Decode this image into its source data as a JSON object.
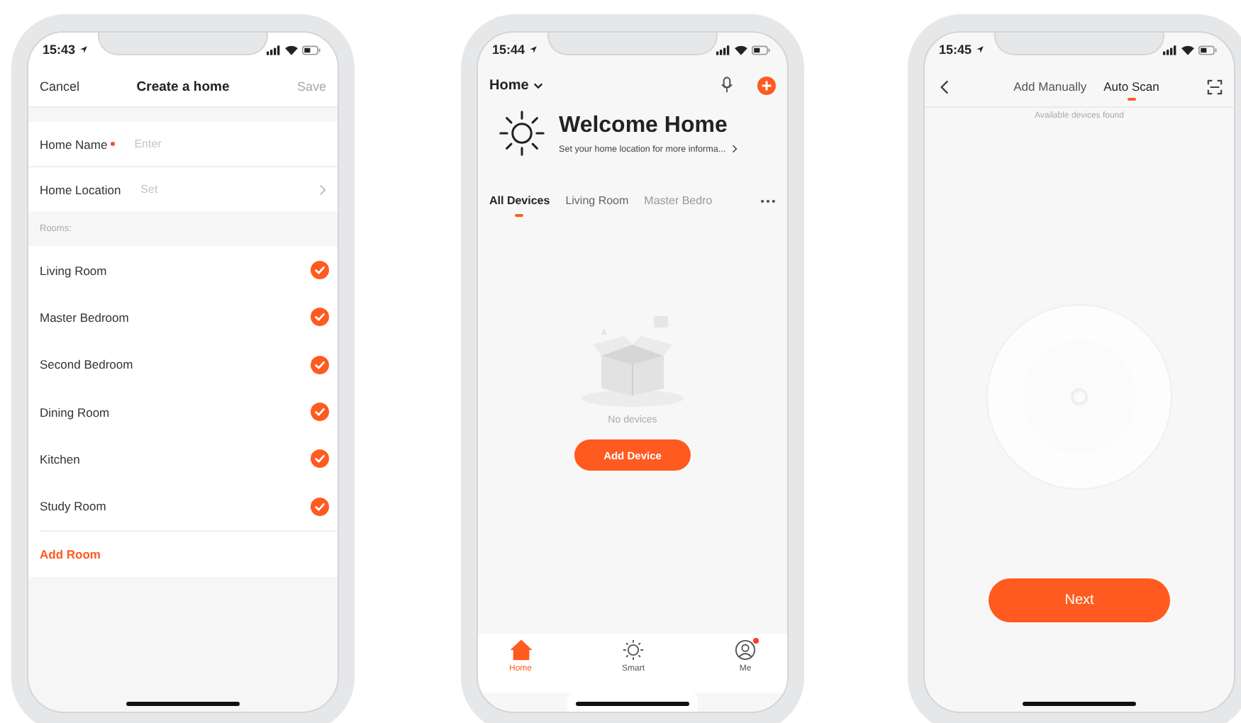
{
  "create_home_screen": {
    "status_bar": {
      "time": "15:43"
    },
    "nav": {
      "cancel": "Cancel",
      "title": "Create a home",
      "save": {
        "label": "Save",
        "disabled": true
      }
    },
    "home_name": {
      "label": "Home Name",
      "required": true,
      "placeholder": "Enter"
    },
    "home_location": {
      "label": "Home Location",
      "placeholder": "Set"
    },
    "rooms_label": "Rooms:",
    "rooms": [
      {
        "name": "Living Room",
        "checked": true
      },
      {
        "name": "Master Bedroom",
        "checked": true
      },
      {
        "name": "Second Bedroom",
        "checked": true
      },
      {
        "name": "Dining Room",
        "checked": true
      },
      {
        "name": "Kitchen",
        "checked": true
      },
      {
        "name": "Study Room",
        "checked": true
      }
    ],
    "add_room": "Add Room"
  },
  "home_screen": {
    "status_bar": {
      "time": "15:44"
    },
    "home_menu": "Home",
    "welcome": {
      "title": "Welcome Home",
      "subtitle": "Set your home location for more informa..."
    },
    "tabs": [
      {
        "label": "All Devices",
        "selected": true
      },
      {
        "label": "Living Room",
        "selected": false
      },
      {
        "label": "Master Bedro",
        "selected": false
      }
    ],
    "empty_message": "No devices",
    "add_device": "Add Device",
    "bottom_nav": [
      {
        "kind": "home",
        "label": "Home",
        "selected": true,
        "notification": false
      },
      {
        "kind": "smart",
        "label": "Smart",
        "selected": false,
        "notification": false
      },
      {
        "kind": "me",
        "label": "Me",
        "selected": false,
        "notification": true
      }
    ]
  },
  "scan_screen": {
    "status_bar": {
      "time": "15:45"
    },
    "tabs": [
      {
        "label": "Add Manually",
        "selected": false
      },
      {
        "label": "Auto Scan",
        "selected": true
      }
    ],
    "subtitle": "Available devices found",
    "next": "Next"
  }
}
